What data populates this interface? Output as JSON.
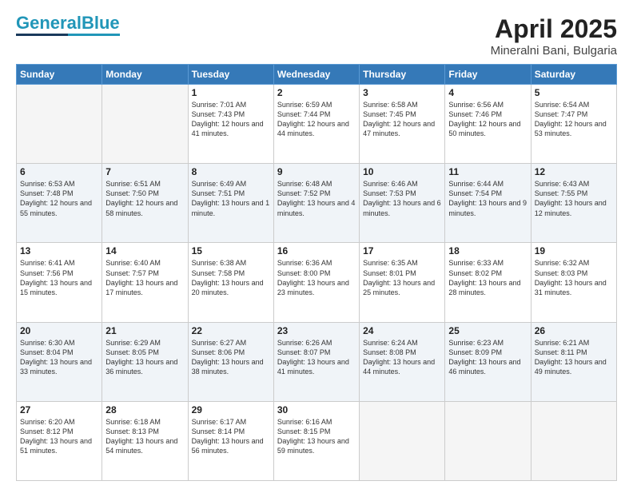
{
  "logo": {
    "part1": "General",
    "part2": "Blue"
  },
  "title": "April 2025",
  "subtitle": "Mineralni Bani, Bulgaria",
  "headers": [
    "Sunday",
    "Monday",
    "Tuesday",
    "Wednesday",
    "Thursday",
    "Friday",
    "Saturday"
  ],
  "weeks": [
    [
      {
        "day": "",
        "info": ""
      },
      {
        "day": "",
        "info": ""
      },
      {
        "day": "1",
        "info": "Sunrise: 7:01 AM\nSunset: 7:43 PM\nDaylight: 12 hours and 41 minutes."
      },
      {
        "day": "2",
        "info": "Sunrise: 6:59 AM\nSunset: 7:44 PM\nDaylight: 12 hours and 44 minutes."
      },
      {
        "day": "3",
        "info": "Sunrise: 6:58 AM\nSunset: 7:45 PM\nDaylight: 12 hours and 47 minutes."
      },
      {
        "day": "4",
        "info": "Sunrise: 6:56 AM\nSunset: 7:46 PM\nDaylight: 12 hours and 50 minutes."
      },
      {
        "day": "5",
        "info": "Sunrise: 6:54 AM\nSunset: 7:47 PM\nDaylight: 12 hours and 53 minutes."
      }
    ],
    [
      {
        "day": "6",
        "info": "Sunrise: 6:53 AM\nSunset: 7:48 PM\nDaylight: 12 hours and 55 minutes."
      },
      {
        "day": "7",
        "info": "Sunrise: 6:51 AM\nSunset: 7:50 PM\nDaylight: 12 hours and 58 minutes."
      },
      {
        "day": "8",
        "info": "Sunrise: 6:49 AM\nSunset: 7:51 PM\nDaylight: 13 hours and 1 minute."
      },
      {
        "day": "9",
        "info": "Sunrise: 6:48 AM\nSunset: 7:52 PM\nDaylight: 13 hours and 4 minutes."
      },
      {
        "day": "10",
        "info": "Sunrise: 6:46 AM\nSunset: 7:53 PM\nDaylight: 13 hours and 6 minutes."
      },
      {
        "day": "11",
        "info": "Sunrise: 6:44 AM\nSunset: 7:54 PM\nDaylight: 13 hours and 9 minutes."
      },
      {
        "day": "12",
        "info": "Sunrise: 6:43 AM\nSunset: 7:55 PM\nDaylight: 13 hours and 12 minutes."
      }
    ],
    [
      {
        "day": "13",
        "info": "Sunrise: 6:41 AM\nSunset: 7:56 PM\nDaylight: 13 hours and 15 minutes."
      },
      {
        "day": "14",
        "info": "Sunrise: 6:40 AM\nSunset: 7:57 PM\nDaylight: 13 hours and 17 minutes."
      },
      {
        "day": "15",
        "info": "Sunrise: 6:38 AM\nSunset: 7:58 PM\nDaylight: 13 hours and 20 minutes."
      },
      {
        "day": "16",
        "info": "Sunrise: 6:36 AM\nSunset: 8:00 PM\nDaylight: 13 hours and 23 minutes."
      },
      {
        "day": "17",
        "info": "Sunrise: 6:35 AM\nSunset: 8:01 PM\nDaylight: 13 hours and 25 minutes."
      },
      {
        "day": "18",
        "info": "Sunrise: 6:33 AM\nSunset: 8:02 PM\nDaylight: 13 hours and 28 minutes."
      },
      {
        "day": "19",
        "info": "Sunrise: 6:32 AM\nSunset: 8:03 PM\nDaylight: 13 hours and 31 minutes."
      }
    ],
    [
      {
        "day": "20",
        "info": "Sunrise: 6:30 AM\nSunset: 8:04 PM\nDaylight: 13 hours and 33 minutes."
      },
      {
        "day": "21",
        "info": "Sunrise: 6:29 AM\nSunset: 8:05 PM\nDaylight: 13 hours and 36 minutes."
      },
      {
        "day": "22",
        "info": "Sunrise: 6:27 AM\nSunset: 8:06 PM\nDaylight: 13 hours and 38 minutes."
      },
      {
        "day": "23",
        "info": "Sunrise: 6:26 AM\nSunset: 8:07 PM\nDaylight: 13 hours and 41 minutes."
      },
      {
        "day": "24",
        "info": "Sunrise: 6:24 AM\nSunset: 8:08 PM\nDaylight: 13 hours and 44 minutes."
      },
      {
        "day": "25",
        "info": "Sunrise: 6:23 AM\nSunset: 8:09 PM\nDaylight: 13 hours and 46 minutes."
      },
      {
        "day": "26",
        "info": "Sunrise: 6:21 AM\nSunset: 8:11 PM\nDaylight: 13 hours and 49 minutes."
      }
    ],
    [
      {
        "day": "27",
        "info": "Sunrise: 6:20 AM\nSunset: 8:12 PM\nDaylight: 13 hours and 51 minutes."
      },
      {
        "day": "28",
        "info": "Sunrise: 6:18 AM\nSunset: 8:13 PM\nDaylight: 13 hours and 54 minutes."
      },
      {
        "day": "29",
        "info": "Sunrise: 6:17 AM\nSunset: 8:14 PM\nDaylight: 13 hours and 56 minutes."
      },
      {
        "day": "30",
        "info": "Sunrise: 6:16 AM\nSunset: 8:15 PM\nDaylight: 13 hours and 59 minutes."
      },
      {
        "day": "",
        "info": ""
      },
      {
        "day": "",
        "info": ""
      },
      {
        "day": "",
        "info": ""
      }
    ]
  ]
}
